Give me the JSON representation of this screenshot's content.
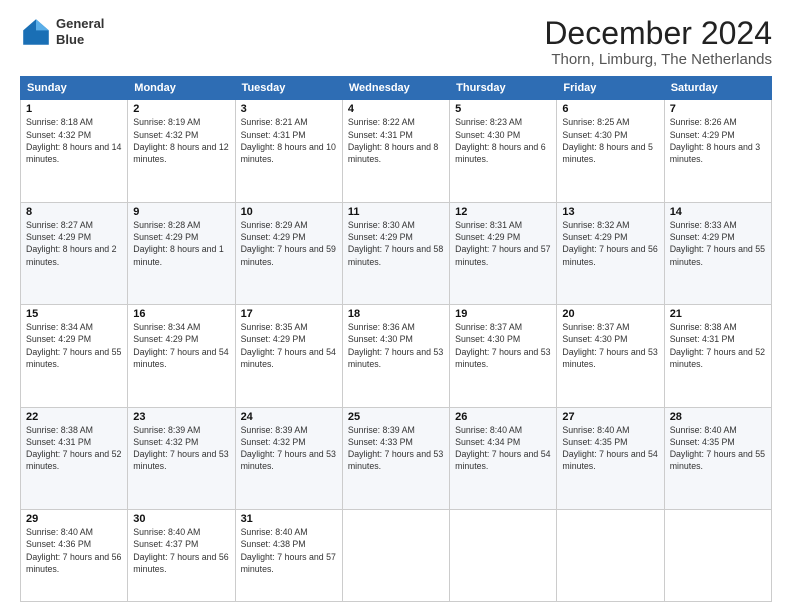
{
  "logo": {
    "line1": "General",
    "line2": "Blue"
  },
  "title": "December 2024",
  "subtitle": "Thorn, Limburg, The Netherlands",
  "weekdays": [
    "Sunday",
    "Monday",
    "Tuesday",
    "Wednesday",
    "Thursday",
    "Friday",
    "Saturday"
  ],
  "weeks": [
    [
      {
        "day": "1",
        "sunrise": "8:18 AM",
        "sunset": "4:32 PM",
        "daylight": "8 hours and 14 minutes."
      },
      {
        "day": "2",
        "sunrise": "8:19 AM",
        "sunset": "4:32 PM",
        "daylight": "8 hours and 12 minutes."
      },
      {
        "day": "3",
        "sunrise": "8:21 AM",
        "sunset": "4:31 PM",
        "daylight": "8 hours and 10 minutes."
      },
      {
        "day": "4",
        "sunrise": "8:22 AM",
        "sunset": "4:31 PM",
        "daylight": "8 hours and 8 minutes."
      },
      {
        "day": "5",
        "sunrise": "8:23 AM",
        "sunset": "4:30 PM",
        "daylight": "8 hours and 6 minutes."
      },
      {
        "day": "6",
        "sunrise": "8:25 AM",
        "sunset": "4:30 PM",
        "daylight": "8 hours and 5 minutes."
      },
      {
        "day": "7",
        "sunrise": "8:26 AM",
        "sunset": "4:29 PM",
        "daylight": "8 hours and 3 minutes."
      }
    ],
    [
      {
        "day": "8",
        "sunrise": "8:27 AM",
        "sunset": "4:29 PM",
        "daylight": "8 hours and 2 minutes."
      },
      {
        "day": "9",
        "sunrise": "8:28 AM",
        "sunset": "4:29 PM",
        "daylight": "8 hours and 1 minute."
      },
      {
        "day": "10",
        "sunrise": "8:29 AM",
        "sunset": "4:29 PM",
        "daylight": "7 hours and 59 minutes."
      },
      {
        "day": "11",
        "sunrise": "8:30 AM",
        "sunset": "4:29 PM",
        "daylight": "7 hours and 58 minutes."
      },
      {
        "day": "12",
        "sunrise": "8:31 AM",
        "sunset": "4:29 PM",
        "daylight": "7 hours and 57 minutes."
      },
      {
        "day": "13",
        "sunrise": "8:32 AM",
        "sunset": "4:29 PM",
        "daylight": "7 hours and 56 minutes."
      },
      {
        "day": "14",
        "sunrise": "8:33 AM",
        "sunset": "4:29 PM",
        "daylight": "7 hours and 55 minutes."
      }
    ],
    [
      {
        "day": "15",
        "sunrise": "8:34 AM",
        "sunset": "4:29 PM",
        "daylight": "7 hours and 55 minutes."
      },
      {
        "day": "16",
        "sunrise": "8:34 AM",
        "sunset": "4:29 PM",
        "daylight": "7 hours and 54 minutes."
      },
      {
        "day": "17",
        "sunrise": "8:35 AM",
        "sunset": "4:29 PM",
        "daylight": "7 hours and 54 minutes."
      },
      {
        "day": "18",
        "sunrise": "8:36 AM",
        "sunset": "4:30 PM",
        "daylight": "7 hours and 53 minutes."
      },
      {
        "day": "19",
        "sunrise": "8:37 AM",
        "sunset": "4:30 PM",
        "daylight": "7 hours and 53 minutes."
      },
      {
        "day": "20",
        "sunrise": "8:37 AM",
        "sunset": "4:30 PM",
        "daylight": "7 hours and 53 minutes."
      },
      {
        "day": "21",
        "sunrise": "8:38 AM",
        "sunset": "4:31 PM",
        "daylight": "7 hours and 52 minutes."
      }
    ],
    [
      {
        "day": "22",
        "sunrise": "8:38 AM",
        "sunset": "4:31 PM",
        "daylight": "7 hours and 52 minutes."
      },
      {
        "day": "23",
        "sunrise": "8:39 AM",
        "sunset": "4:32 PM",
        "daylight": "7 hours and 53 minutes."
      },
      {
        "day": "24",
        "sunrise": "8:39 AM",
        "sunset": "4:32 PM",
        "daylight": "7 hours and 53 minutes."
      },
      {
        "day": "25",
        "sunrise": "8:39 AM",
        "sunset": "4:33 PM",
        "daylight": "7 hours and 53 minutes."
      },
      {
        "day": "26",
        "sunrise": "8:40 AM",
        "sunset": "4:34 PM",
        "daylight": "7 hours and 54 minutes."
      },
      {
        "day": "27",
        "sunrise": "8:40 AM",
        "sunset": "4:35 PM",
        "daylight": "7 hours and 54 minutes."
      },
      {
        "day": "28",
        "sunrise": "8:40 AM",
        "sunset": "4:35 PM",
        "daylight": "7 hours and 55 minutes."
      }
    ],
    [
      {
        "day": "29",
        "sunrise": "8:40 AM",
        "sunset": "4:36 PM",
        "daylight": "7 hours and 56 minutes."
      },
      {
        "day": "30",
        "sunrise": "8:40 AM",
        "sunset": "4:37 PM",
        "daylight": "7 hours and 56 minutes."
      },
      {
        "day": "31",
        "sunrise": "8:40 AM",
        "sunset": "4:38 PM",
        "daylight": "7 hours and 57 minutes."
      },
      null,
      null,
      null,
      null
    ]
  ]
}
